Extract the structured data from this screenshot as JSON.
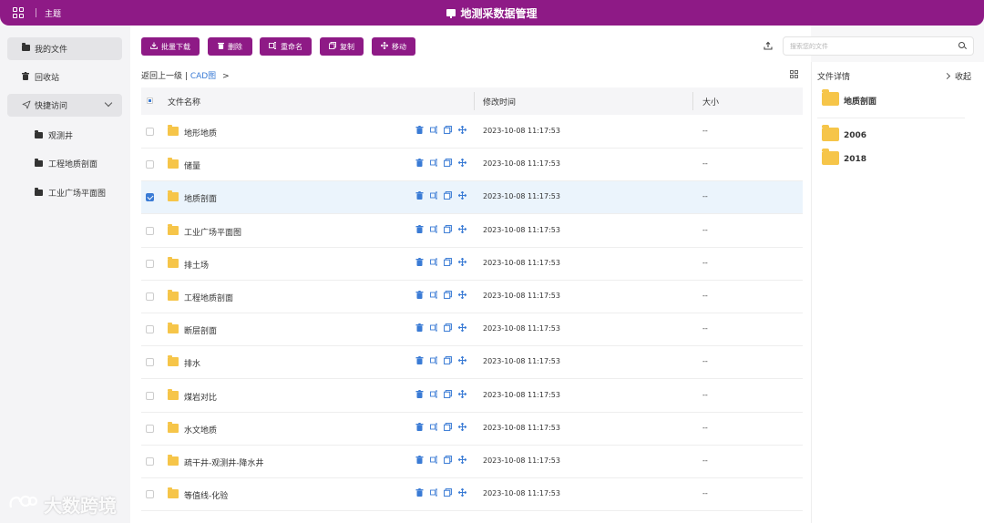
{
  "header": {
    "theme_label": "主题",
    "title": "地测采数据管理"
  },
  "sidebar": {
    "items": [
      {
        "label": "我的文件",
        "icon": "folder-icon"
      },
      {
        "label": "回收站",
        "icon": "trash-icon"
      },
      {
        "label": "快捷访问",
        "icon": "send-icon"
      }
    ],
    "quick_access": [
      {
        "label": "观测井"
      },
      {
        "label": "工程地质剖面"
      },
      {
        "label": "工业广场平面图"
      }
    ]
  },
  "toolbar": {
    "download": "批量下载",
    "delete": "删除",
    "rename": "重命名",
    "copy": "复制",
    "move": "移动"
  },
  "search": {
    "placeholder": "搜索您的文件"
  },
  "breadcrumb": {
    "back": "返回上一级",
    "separator": "|",
    "current": "CAD图",
    "arrow": ">"
  },
  "table": {
    "columns": [
      "文件名称",
      "修改时间",
      "大小"
    ],
    "rows": [
      {
        "name": "地形地质",
        "time": "2023-10-08 11:17:53",
        "size": "--",
        "selected": false
      },
      {
        "name": "储量",
        "time": "2023-10-08 11:17:53",
        "size": "--",
        "selected": false
      },
      {
        "name": "地质剖面",
        "time": "2023-10-08 11:17:53",
        "size": "--",
        "selected": true
      },
      {
        "name": "工业广场平面图",
        "time": "2023-10-08 11:17:53",
        "size": "--",
        "selected": false
      },
      {
        "name": "排土场",
        "time": "2023-10-08 11:17:53",
        "size": "--",
        "selected": false
      },
      {
        "name": "工程地质剖面",
        "time": "2023-10-08 11:17:53",
        "size": "--",
        "selected": false
      },
      {
        "name": "断层剖面",
        "time": "2023-10-08 11:17:53",
        "size": "--",
        "selected": false
      },
      {
        "name": "排水",
        "time": "2023-10-08 11:17:53",
        "size": "--",
        "selected": false
      },
      {
        "name": "煤岩对比",
        "time": "2023-10-08 11:17:53",
        "size": "--",
        "selected": false
      },
      {
        "name": "水文地质",
        "time": "2023-10-08 11:17:53",
        "size": "--",
        "selected": false
      },
      {
        "name": "疏干井-观测井-降水井",
        "time": "2023-10-08 11:17:53",
        "size": "--",
        "selected": false
      },
      {
        "name": "等值线-化验",
        "time": "2023-10-08 11:17:53",
        "size": "--",
        "selected": false
      }
    ]
  },
  "details": {
    "title": "文件详情",
    "collapse": "收起",
    "selected_name": "地质剖面",
    "children": [
      {
        "name": "2006"
      },
      {
        "name": "2018"
      }
    ]
  },
  "watermark": {
    "text": "大数跨境"
  },
  "colors": {
    "brand": "#8e1a86",
    "accent": "#3a7bd5",
    "folder": "#f6c549",
    "selected_row": "#ebf4fc"
  }
}
